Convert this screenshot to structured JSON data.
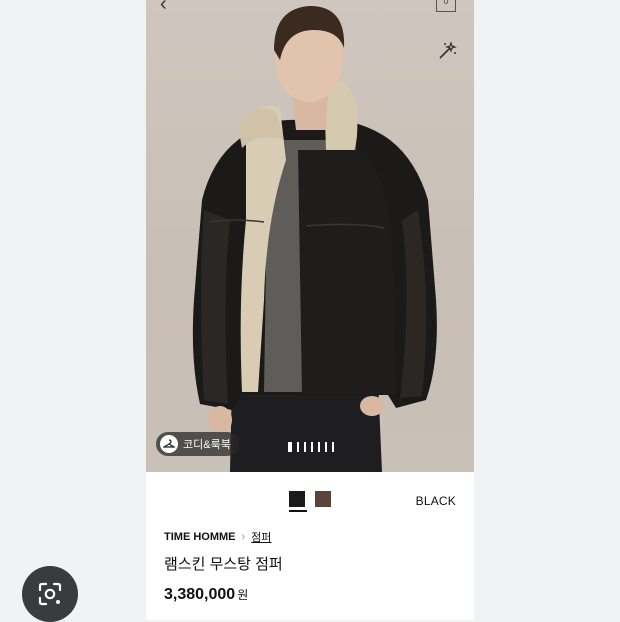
{
  "header": {
    "cart_count": "0"
  },
  "hero": {
    "coordi_label": "코디&룩북",
    "page_count": 7,
    "active_page": 1
  },
  "options": {
    "colors": [
      {
        "name": "black",
        "hex": "#1b1b1b",
        "selected": true
      },
      {
        "name": "brown",
        "hex": "#5a4538",
        "selected": false
      }
    ],
    "selected_color_label": "BLACK"
  },
  "product": {
    "brand": "TIME HOMME",
    "category": "점퍼",
    "name": "램스킨 무스탕 점퍼",
    "price": "3,380,000",
    "currency": "원"
  },
  "icons": {
    "back": "chevron-left-icon",
    "cart": "shopping-bag-icon",
    "magic": "magic-wand-icon",
    "coordi": "hanger-icon",
    "lens": "lens-search-icon"
  }
}
